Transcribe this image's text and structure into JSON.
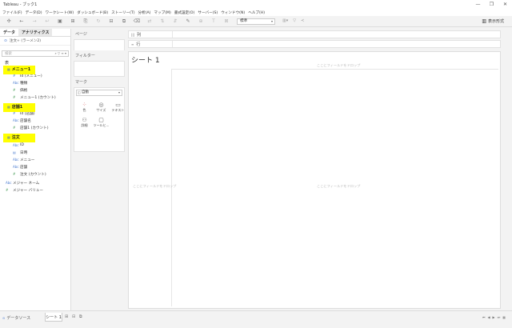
{
  "window": {
    "title": "Tableau - ブック1",
    "controls": [
      "—",
      "❐",
      "✕"
    ]
  },
  "menu": [
    "ファイル(F)",
    "データ(D)",
    "ワークシート(W)",
    "ダッシュボード(B)",
    "ストーリー(T)",
    "分析(A)",
    "マップ(M)",
    "書式設定(O)",
    "サーバー(S)",
    "ウィンドウ(N)",
    "ヘルプ(H)"
  ],
  "toolbar": {
    "fit_value": "標準",
    "show_me": "表示形式"
  },
  "data_pane": {
    "tab_data": "データ",
    "tab_analytics": "アナリティクス",
    "datasource": "注文+ (ラーメン2)",
    "search_placeholder": "検索",
    "section_tables": "表",
    "tables": [
      {
        "name": "メニュー1",
        "fields": [
          "Id (メニュー)",
          "種類",
          "価格",
          "メニュー1 (カウント)"
        ]
      },
      {
        "name": "店舗1",
        "fields": [
          "Id (店舗)",
          "店舗名",
          "店舗1 (カウント)"
        ]
      },
      {
        "name": "注文",
        "fields": [
          "ID",
          "日時",
          "メニュー",
          "店舗",
          "注文 (カウント)"
        ]
      }
    ],
    "measure_names": "メジャー ネーム",
    "measure_values": "メジャー バリュー",
    "highlight_color": "#ffff00"
  },
  "shelves": {
    "pages": "ページ",
    "filters": "フィルター",
    "marks": "マーク",
    "marks_type": "自動",
    "mark_buttons": [
      {
        "label": "色",
        "icon": "color-icon"
      },
      {
        "label": "サイズ",
        "icon": "size-icon"
      },
      {
        "label": "テキスト",
        "icon": "text-icon"
      },
      {
        "label": "詳細",
        "icon": "detail-icon"
      },
      {
        "label": "ツールヒ...",
        "icon": "tooltip-icon"
      }
    ],
    "columns": "列",
    "rows": "行"
  },
  "sheet": {
    "title": "シート 1",
    "drop_top": "ここにフィールドをドロップ",
    "drop_left": "ここにフィールドをドロップ",
    "drop_center": "ここにフィールドをドロップ"
  },
  "status": {
    "datasource_tab": "データソース",
    "sheet_tab": "シート 1"
  }
}
